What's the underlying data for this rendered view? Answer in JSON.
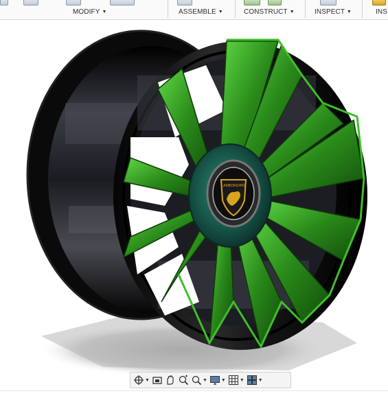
{
  "toolbar": {
    "modify_label": "MODIFY",
    "assemble_label": "ASSEMBLE",
    "construct_label": "CONSTRUCT",
    "inspect_label": "INSPECT",
    "insert_label": "INS",
    "dropdown_glyph": "▼"
  },
  "viewport": {
    "badge_text": "LAMBORGHINI",
    "colors": {
      "spoke_green": "#2f9a1f",
      "barrel_black": "#0b0b0b",
      "hub_teal": "#1f6f5a",
      "badge_gold": "#d9a520"
    }
  },
  "navbar": {
    "items": [
      "orbit-icon",
      "look-at-icon",
      "pan-icon",
      "zoom-icon",
      "fit-icon",
      "display-settings-icon",
      "grid-icon",
      "viewports-icon"
    ]
  }
}
